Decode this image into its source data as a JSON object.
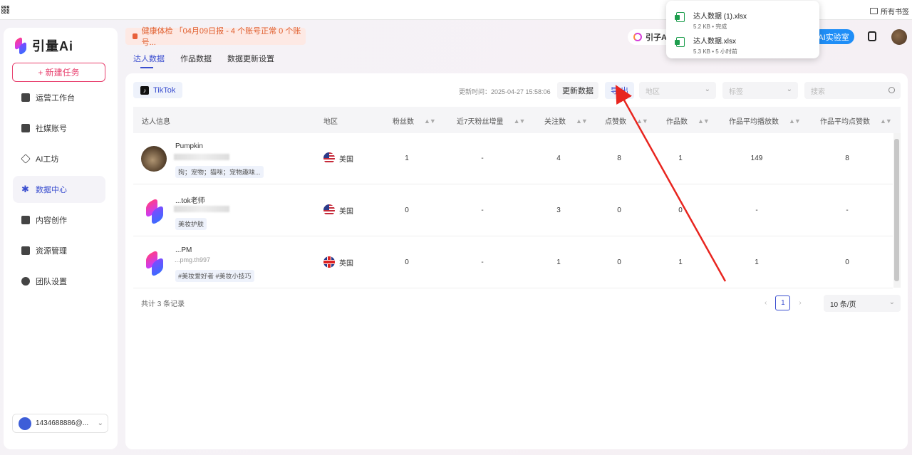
{
  "browser": {
    "all_bookmarks": "所有书签"
  },
  "sidebar": {
    "logo_text": "引量Ai",
    "new_task": "+ 新建任务",
    "items": [
      {
        "label": "运营工作台",
        "icon": "org-chart-icon"
      },
      {
        "label": "社媒账号",
        "icon": "calendar-icon"
      },
      {
        "label": "AI工坊",
        "icon": "diamond-icon"
      },
      {
        "label": "数据中心",
        "icon": "star-icon"
      },
      {
        "label": "内容创作",
        "icon": "folder-icon"
      },
      {
        "label": "资源管理",
        "icon": "briefcase-icon"
      },
      {
        "label": "团队设置",
        "icon": "team-icon"
      }
    ],
    "active_index": 3,
    "user": "1434688886@..."
  },
  "header": {
    "health_text": "健康体检  「04月09日报 - 4 个账号正常 0 个账号...",
    "tabs": [
      "达人数据",
      "作品数据",
      "数据更新设置"
    ],
    "active_tab": 0,
    "yinzi": "引子A",
    "ai_lab": "AI实验室"
  },
  "toolbar": {
    "platform": "TikTok",
    "update_time": "更新时间：2025-04-27 15:58:06",
    "update_btn": "更新数据",
    "export_btn": "导 出",
    "region_placeholder": "地区",
    "tag_placeholder": "标签",
    "search_placeholder": "搜索"
  },
  "table": {
    "headers": [
      "达人信息",
      "地区",
      "粉丝数",
      "近7天粉丝增量",
      "关注数",
      "点赞数",
      "作品数",
      "作品平均播放数",
      "作品平均点赞数"
    ],
    "rows": [
      {
        "name": "Pumpkin",
        "sub": "ID:...",
        "tags": "狗；宠物；猫咪；宠物趣味...",
        "region": "美国",
        "flag": "us",
        "fans": "1",
        "fans7d": "-",
        "follow": "4",
        "likes": "8",
        "works": "1",
        "avg_play": "149",
        "avg_like": "8"
      },
      {
        "name": "...tok老师",
        "sub": "",
        "tags": "美妆护肤",
        "region": "美国",
        "flag": "us",
        "fans": "0",
        "fans7d": "-",
        "follow": "3",
        "likes": "0",
        "works": "0",
        "avg_play": "-",
        "avg_like": "-"
      },
      {
        "name": "...PM",
        "sub": "...pmg.th997",
        "tags": "#美妆爱好者 #美妆小技巧",
        "region": "英国",
        "flag": "uk",
        "fans": "0",
        "fans7d": "-",
        "follow": "1",
        "likes": "0",
        "works": "1",
        "avg_play": "1",
        "avg_like": "0"
      }
    ]
  },
  "footer": {
    "total": "共计 3 条记录",
    "page": "1",
    "page_size": "10 条/页"
  },
  "downloads": [
    {
      "name": "达人数据 (1).xlsx",
      "meta": "5.2 KB • 完成"
    },
    {
      "name": "达人数据.xlsx",
      "meta": "5.3 KB • 5 小时前"
    }
  ],
  "colors": {
    "accent": "#3a4ecf",
    "brand_pink": "#e8406e",
    "annotation_arrow": "#e8251f"
  }
}
